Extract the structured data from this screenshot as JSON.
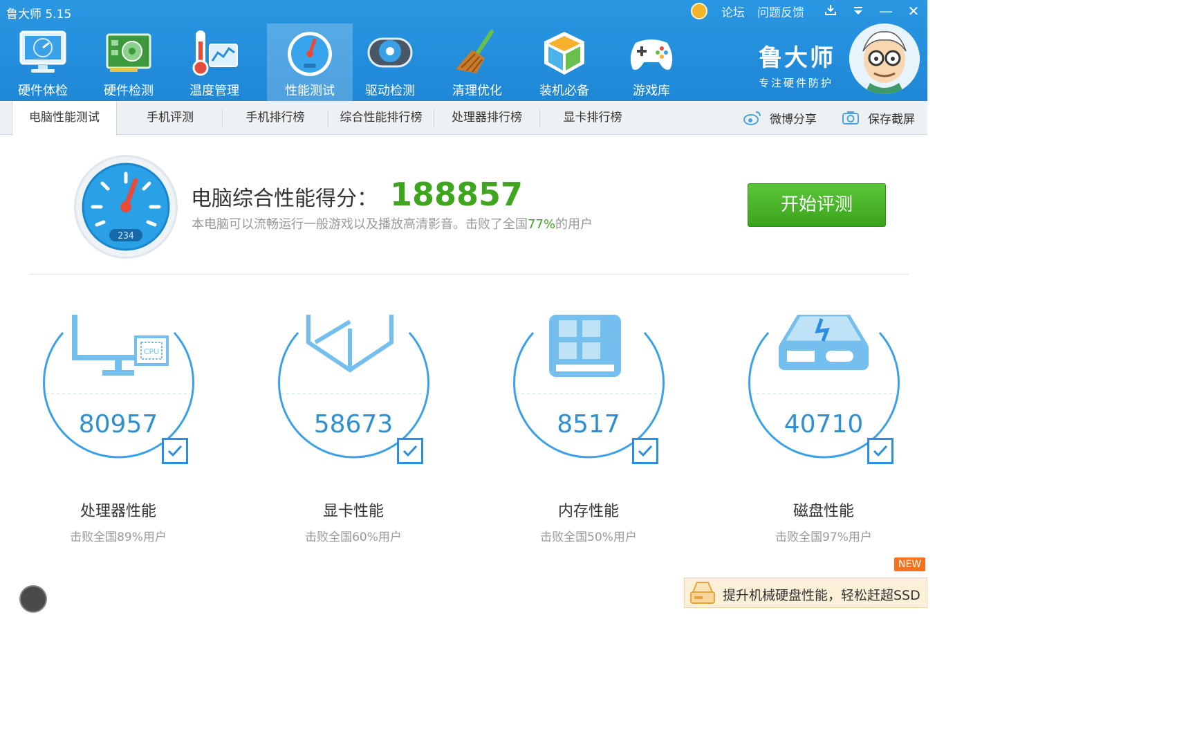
{
  "window": {
    "title": "鲁大师 5.15"
  },
  "topbar": {
    "forum": "论坛",
    "feedback": "问题反馈",
    "download_icon": "download-icon",
    "menu_icon": "menu-icon",
    "minimize": "—",
    "close": "✕"
  },
  "toolbar": [
    {
      "label": "硬件体检",
      "icon": "monitor-check-icon"
    },
    {
      "label": "硬件检测",
      "icon": "hardware-card-icon"
    },
    {
      "label": "温度管理",
      "icon": "thermometer-icon"
    },
    {
      "label": "性能测试",
      "icon": "speedometer-icon",
      "active": true
    },
    {
      "label": "驱动检测",
      "icon": "driver-gear-icon"
    },
    {
      "label": "清理优化",
      "icon": "broom-icon"
    },
    {
      "label": "装机必备",
      "icon": "cube-icon"
    },
    {
      "label": "游戏库",
      "icon": "gamepad-icon"
    }
  ],
  "brand": {
    "name": "鲁大师",
    "slogan": "专注硬件防护"
  },
  "tabs": [
    "电脑性能测试",
    "手机评测",
    "手机排行榜",
    "综合性能排行榜",
    "处理器排行榜",
    "显卡排行榜"
  ],
  "tab_actions": {
    "share": "微博分享",
    "screenshot": "保存截屏"
  },
  "summary": {
    "label": "电脑综合性能得分：",
    "score": "188857",
    "gauge_readout": "234",
    "desc_prefix": "本电脑可以流畅运行一般游戏以及播放高清影音。击败了全国",
    "desc_pct": "77%",
    "desc_suffix": "的用户",
    "start_button": "开始评测"
  },
  "cards": [
    {
      "value": "80957",
      "name": "处理器性能",
      "sub": "击败全国89%用户",
      "icon": "cpu-monitor-icon",
      "chip_text": "CPU"
    },
    {
      "value": "58673",
      "name": "显卡性能",
      "sub": "击败全国60%用户",
      "icon": "graphics-cube-icon"
    },
    {
      "value": "8517",
      "name": "内存性能",
      "sub": "击败全国50%用户",
      "icon": "memory-chip-icon"
    },
    {
      "value": "40710",
      "name": "磁盘性能",
      "sub": "击败全国97%用户",
      "icon": "disk-drive-icon"
    }
  ],
  "promo": {
    "badge": "NEW",
    "text": "提升机械硬盘性能，轻松赶超SSD"
  },
  "colors": {
    "header_blue": "#1e87d6",
    "score_green": "#3fa41e",
    "accent_blue": "#2b8ee0",
    "promo_bg": "#fdf0d8"
  }
}
